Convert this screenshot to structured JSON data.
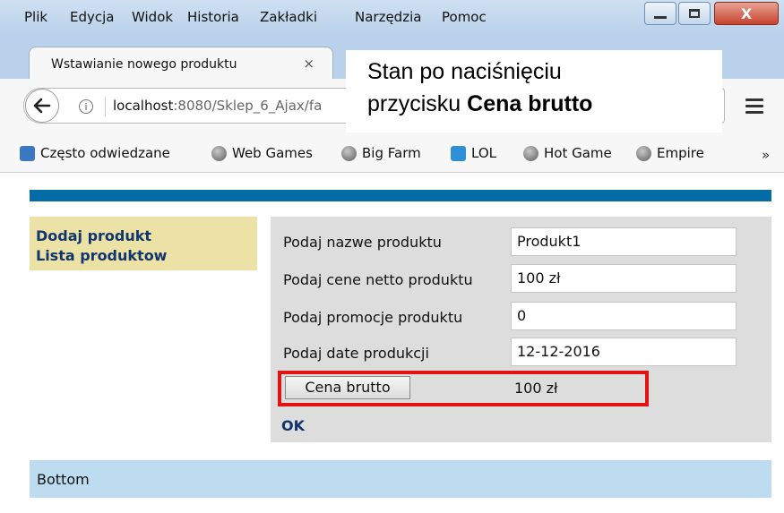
{
  "menubar": {
    "items": [
      "Plik",
      "Edycja",
      "Widok",
      "Historia",
      "Zakładki",
      "Narzędzia",
      "Pomoc"
    ]
  },
  "window_controls": {
    "minimize": "–",
    "maximize": "□",
    "close": "X"
  },
  "tab": {
    "title": "Wstawianie nowego produktu",
    "close": "×"
  },
  "navbar": {
    "url_host": "localhost",
    "url_path": ":8080/Sklep_6_Ajax/fa"
  },
  "bookmarks": [
    {
      "label": "Często odwiedzane",
      "icon": "bookmark-folder-icon"
    },
    {
      "label": "Web Games",
      "icon": "globe-icon"
    },
    {
      "label": "Big Farm",
      "icon": "globe-icon"
    },
    {
      "label": "LOL",
      "icon": "lol-icon"
    },
    {
      "label": "Hot Game",
      "icon": "globe-icon"
    },
    {
      "label": "Empire",
      "icon": "globe-icon"
    }
  ],
  "bookmarks_overflow": "»",
  "callout": {
    "line1": "Stan po naciśnięciu",
    "line2_prefix": "przycisku ",
    "line2_bold": "Cena brutto"
  },
  "page": {
    "nav": {
      "add": "Dodaj produkt",
      "list": "Lista produktow"
    },
    "form": {
      "name_label": "Podaj nazwe produktu",
      "name_value": "Produkt1",
      "net_label": "Podaj cene netto produktu",
      "net_value": "100 zł",
      "promo_label": "Podaj promocje produktu",
      "promo_value": "0",
      "date_label": "Podaj date produkcji",
      "date_value": "12-12-2016",
      "gross_button": "Cena brutto",
      "gross_value": "100 zł",
      "ok": "OK"
    },
    "bottom": "Bottom"
  },
  "colors": {
    "topbar": "#036ba5",
    "leftnav": "#ede2a6",
    "bottombar": "#bddcef",
    "highlight": "#e11313"
  }
}
